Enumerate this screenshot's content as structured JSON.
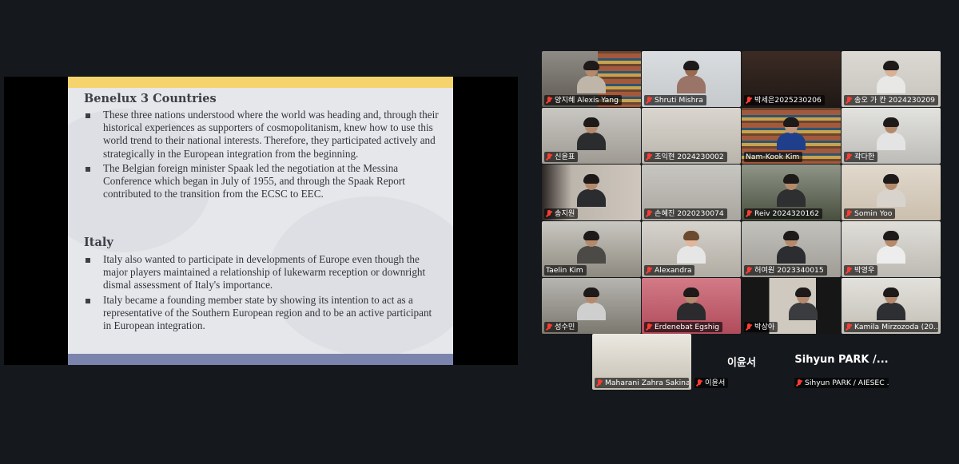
{
  "slide": {
    "section1": {
      "title": "Benelux 3 Countries",
      "bullets": [
        "These three nations understood where the world was heading and, through their historical experiences as supporters of cosmopolitanism, knew how to use this world trend to their national interests. Therefore, they participated actively and strategically in the European integration from the beginning.",
        "The Belgian foreign minister Spaak led the negotiation at the Messina Conference which began in July of 1955, and through the Spaak Report contributed to the transition from the ECSC to EEC."
      ]
    },
    "section2": {
      "title": "Italy",
      "bullets": [
        "Italy also wanted to participate in developments of Europe even though the major players maintained a relationship of lukewarm reception or downright dismal assessment of Italy's importance.",
        "Italy became a founding member state by showing its intention to act as a representative of the Southern European region and to be an active participant in European integration."
      ]
    }
  },
  "participants": [
    {
      "name": "양지혜 Alexis Yang",
      "muted": true
    },
    {
      "name": "Shruti Mishra",
      "muted": true
    },
    {
      "name": "박세은2025230206",
      "muted": true
    },
    {
      "name": "송오 가 칸 2024230209",
      "muted": true
    },
    {
      "name": "신윤표",
      "muted": true
    },
    {
      "name": "조익현 2024230002",
      "muted": true
    },
    {
      "name": "Nam-Kook Kim",
      "muted": false,
      "active_speaker": true
    },
    {
      "name": "곽다한",
      "muted": true
    },
    {
      "name": "송지원",
      "muted": true
    },
    {
      "name": "손혜진 2020230074",
      "muted": true
    },
    {
      "name": "Reiv 2024320162",
      "muted": true
    },
    {
      "name": "Somin Yoo",
      "muted": true
    },
    {
      "name": "Taelin Kim",
      "muted": false
    },
    {
      "name": "Alexandra",
      "muted": true
    },
    {
      "name": "허여원 2023340015",
      "muted": true
    },
    {
      "name": "박영우",
      "muted": true
    },
    {
      "name": "성수민",
      "muted": true
    },
    {
      "name": "Erdenebat Egshig",
      "muted": true
    },
    {
      "name": "박상아",
      "muted": true
    },
    {
      "name": "Kamila Mirzozoda (20...",
      "muted": true
    },
    {
      "name": "Maharani Zahra Sakina",
      "muted": true
    },
    {
      "name": "이윤서",
      "display": "이윤서",
      "muted": true
    },
    {
      "name": "Sihyun PARK / AIESEC ...",
      "display": "Sihyun  PARK  /...",
      "muted": true
    }
  ],
  "colors": {
    "background": "#15181c",
    "active_speaker_border": "#23d959",
    "muted_mic": "#ff3b30",
    "slide_top_bar": "#f5d46e",
    "slide_bottom_bar": "#7b84ad"
  }
}
